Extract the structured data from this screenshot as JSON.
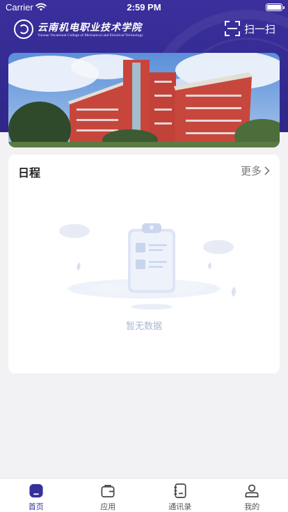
{
  "status_bar": {
    "carrier": "Carrier",
    "time": "2:59 PM"
  },
  "header": {
    "school_name_cn": "云南机电职业技术学院",
    "school_name_en": "Yunnan Vocational College of Mechanical and Electrical Technology",
    "scan_label": "扫一扫"
  },
  "schedule": {
    "title": "日程",
    "more_label": "更多",
    "empty_text": "暂无数据"
  },
  "tab_bar": {
    "items": [
      {
        "label": "首页",
        "icon": "home-icon",
        "active": true
      },
      {
        "label": "应用",
        "icon": "briefcase-icon",
        "active": false
      },
      {
        "label": "通讯录",
        "icon": "contacts-book-icon",
        "active": false
      },
      {
        "label": "我的",
        "icon": "user-icon",
        "active": false
      }
    ]
  },
  "colors": {
    "brand": "#35309a",
    "header_bg": "#342b92",
    "empty_text": "#aab6d3",
    "page_bg": "#f2f2f4"
  }
}
